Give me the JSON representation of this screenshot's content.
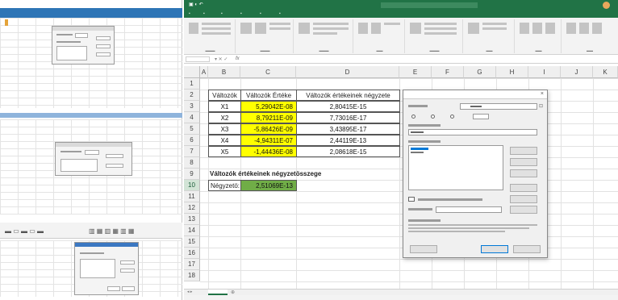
{
  "sheet": {
    "columns": [
      "A",
      "B",
      "C",
      "D",
      "E",
      "F",
      "G",
      "H",
      "I",
      "J",
      "K"
    ],
    "rows": [
      "1",
      "2",
      "3",
      "4",
      "5",
      "6",
      "7",
      "8",
      "9",
      "10",
      "11",
      "12",
      "13",
      "14",
      "15",
      "16",
      "17",
      "18"
    ],
    "selected_row": "10",
    "table": {
      "headers": [
        "Változók",
        "Változók Értéke",
        "Változók értékeinek négyzete"
      ],
      "rows": [
        {
          "name": "X1",
          "value": "5,29042E-08",
          "square": "2,80415E-15"
        },
        {
          "name": "X2",
          "value": "8,79211E-09",
          "square": "7,73016E-17"
        },
        {
          "name": "X3",
          "value": "-5,86426E-09",
          "square": "3,43895E-17"
        },
        {
          "name": "X4",
          "value": "-4,94311E-07",
          "square": "2,44119E-13"
        },
        {
          "name": "X5",
          "value": "-1,44436E-08",
          "square": "2,08618E-15"
        }
      ]
    },
    "sum_title": "Változók értékeinek négyzetösszege",
    "goal_label": "Négyzetö:",
    "goal_value": "2,51069E-13"
  },
  "colors": {
    "excel_green": "#217346",
    "highlight_yellow": "#ffff00",
    "result_green": "#70ad47"
  }
}
